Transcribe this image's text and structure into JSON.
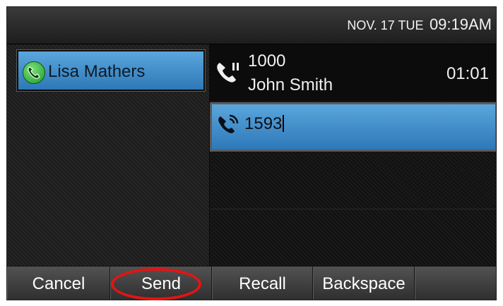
{
  "status_bar": {
    "date": "NOV. 17 TUE",
    "time": "09:19AM"
  },
  "line_key": {
    "label": "Lisa Mathers",
    "icon": "phone-line-icon",
    "color": "#3a8bcb"
  },
  "active_call": {
    "icon": "phone-hold-icon",
    "number": "1000",
    "name": "John Smith",
    "timer": "01:01"
  },
  "dial_entry": {
    "icon": "phone-dial-icon",
    "digits": "1593"
  },
  "softkeys": [
    {
      "label": "Cancel"
    },
    {
      "label": "Send"
    },
    {
      "label": "Recall"
    },
    {
      "label": "Backspace"
    },
    {
      "label": ""
    }
  ],
  "highlight_color": "#e31414"
}
